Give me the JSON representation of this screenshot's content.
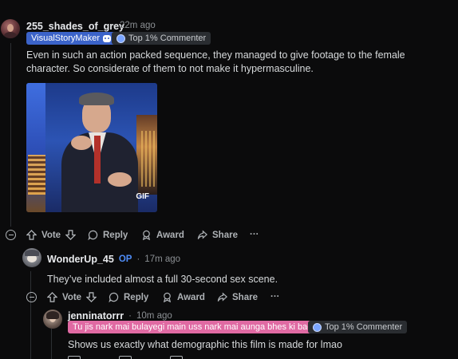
{
  "comments": [
    {
      "username": "255_shades_of_grey",
      "time": "22m ago",
      "flair": "VisualStoryMaker",
      "badge": "Top 1% Commenter",
      "body": "Even in such an action packed sequence, they managed to give footage to the female character. So considerate of them to not make it hypermasculine.",
      "gif_label": "GIF"
    },
    {
      "username": "WonderUp_45",
      "op": "OP",
      "time": "17m ago",
      "body": "They’ve included almost a full 30-second sex scene."
    },
    {
      "username": "jenninatorrr",
      "time": "10m ago",
      "flair": "Tu jis nark mai bulayegi main uss nark mai aunga bhes ki bacchi",
      "badge": "Top 1% Commenter",
      "body": "Shows us exactly what demographic this film is made for lmao"
    }
  ],
  "actions": {
    "vote": "Vote",
    "reply": "Reply",
    "award": "Award",
    "share": "Share",
    "more": "···"
  },
  "separator": "·",
  "colors": {
    "background": "#0b0b0c",
    "op": "#4f8cf7",
    "flair_blue": "#3b63c9",
    "flair_pink": "#e06aa3"
  }
}
